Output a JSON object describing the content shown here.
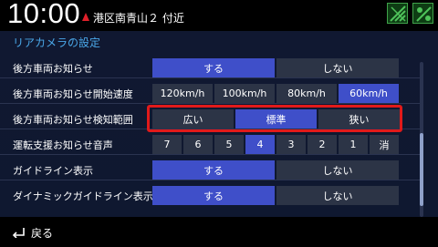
{
  "status": {
    "time": "10:00",
    "location": "港区南青山２ 付近"
  },
  "screen": {
    "title": "リアカメラの設定"
  },
  "settings": [
    {
      "label": "後方車両お知らせ",
      "options": [
        "する",
        "しない"
      ],
      "selected": "する"
    },
    {
      "label": "後方車両お知らせ開始速度",
      "options": [
        "120km/h",
        "100km/h",
        "80km/h",
        "60km/h"
      ],
      "selected": "60km/h"
    },
    {
      "label": "後方車両お知らせ検知範囲",
      "options": [
        "広い",
        "標準",
        "狭い"
      ],
      "selected": "標準"
    },
    {
      "label": "運転支援お知らせ音声",
      "options": [
        "7",
        "6",
        "5",
        "4",
        "3",
        "2",
        "1",
        "消"
      ],
      "selected": "4"
    },
    {
      "label": "ガイドライン表示",
      "options": [
        "する",
        "しない"
      ],
      "selected": "する"
    },
    {
      "label": "ダイナミックガイドライン表示",
      "options": [
        "する",
        "しない"
      ],
      "selected": "する"
    }
  ],
  "footer": {
    "back_label": "戻る"
  },
  "colors": {
    "selected": "#3f4fc9",
    "unselected": "#2c3446",
    "title": "#4aa7e8",
    "highlight": "#e11a1a"
  }
}
